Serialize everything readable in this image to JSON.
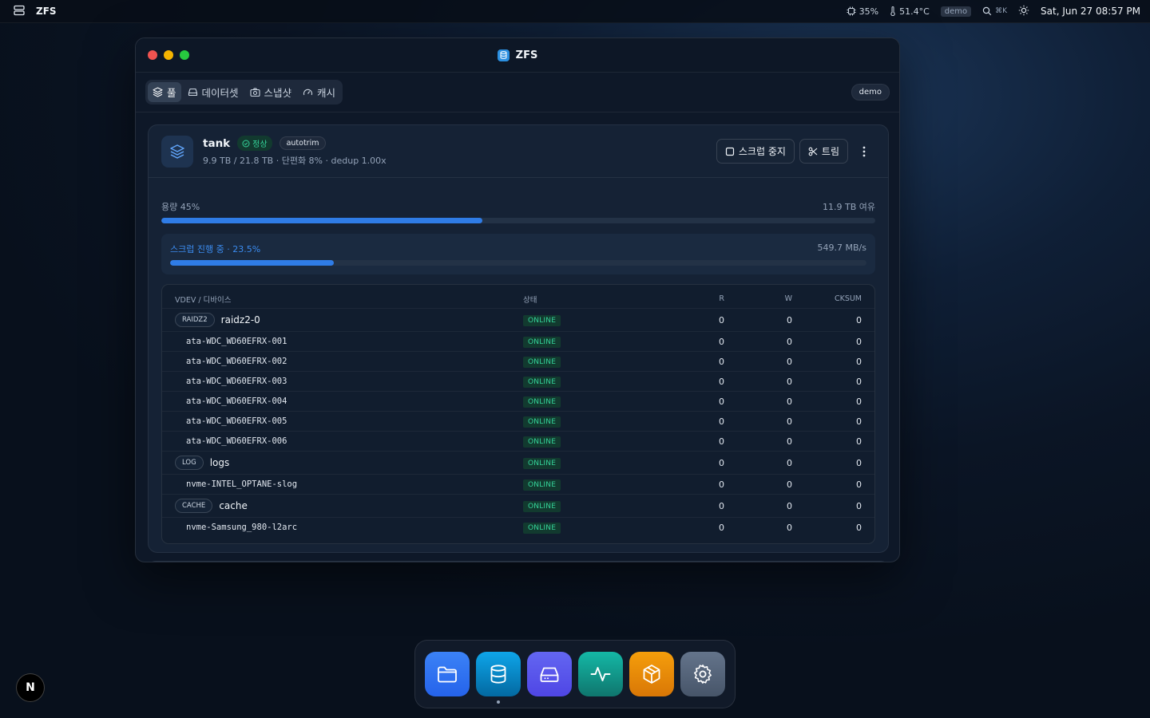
{
  "menubar": {
    "app_name": "ZFS",
    "cpu": "35%",
    "temp": "51.4°C",
    "mode_badge": "demo",
    "search_shortcut": "⌘K",
    "clock": "Sat, Jun 27 08:57 PM"
  },
  "window": {
    "title": "ZFS",
    "tabs": [
      {
        "label": "풀",
        "icon": "layers-icon",
        "active": true
      },
      {
        "label": "데이터셋",
        "icon": "drive-icon",
        "active": false
      },
      {
        "label": "스냅샷",
        "icon": "camera-icon",
        "active": false
      },
      {
        "label": "캐시",
        "icon": "gauge-icon",
        "active": false
      }
    ],
    "demo_pill": "demo"
  },
  "pool": {
    "name": "tank",
    "status": "정상",
    "tag": "autotrim",
    "summary": "9.9 TB / 21.8 TB · 단편화 8% · dedup 1.00x",
    "actions": {
      "scrub_stop": "스크럽 중지",
      "trim": "트림"
    },
    "capacity": {
      "label": "용량 45%",
      "free": "11.9 TB 여유",
      "percent": 45
    },
    "scrub": {
      "label": "스크럽 진행 중 · 23.5%",
      "speed": "549.7 MB/s",
      "percent": 23.5
    }
  },
  "vdev_table": {
    "headers": {
      "name": "VDEV / 디바이스",
      "state": "상태",
      "r": "R",
      "w": "W",
      "cksum": "CKSUM"
    },
    "rows": [
      {
        "type": "group",
        "badge": "RAIDZ2",
        "name": "raidz2-0",
        "state": "ONLINE",
        "r": "0",
        "w": "0",
        "cksum": "0"
      },
      {
        "type": "device",
        "name": "ata-WDC_WD60EFRX-001",
        "state": "ONLINE",
        "r": "0",
        "w": "0",
        "cksum": "0"
      },
      {
        "type": "device",
        "name": "ata-WDC_WD60EFRX-002",
        "state": "ONLINE",
        "r": "0",
        "w": "0",
        "cksum": "0"
      },
      {
        "type": "device",
        "name": "ata-WDC_WD60EFRX-003",
        "state": "ONLINE",
        "r": "0",
        "w": "0",
        "cksum": "0"
      },
      {
        "type": "device",
        "name": "ata-WDC_WD60EFRX-004",
        "state": "ONLINE",
        "r": "0",
        "w": "0",
        "cksum": "0"
      },
      {
        "type": "device",
        "name": "ata-WDC_WD60EFRX-005",
        "state": "ONLINE",
        "r": "0",
        "w": "0",
        "cksum": "0"
      },
      {
        "type": "device",
        "name": "ata-WDC_WD60EFRX-006",
        "state": "ONLINE",
        "r": "0",
        "w": "0",
        "cksum": "0"
      },
      {
        "type": "group",
        "badge": "LOG",
        "name": "logs",
        "state": "ONLINE",
        "r": "0",
        "w": "0",
        "cksum": "0"
      },
      {
        "type": "device",
        "name": "nvme-INTEL_OPTANE-slog",
        "state": "ONLINE",
        "r": "0",
        "w": "0",
        "cksum": "0"
      },
      {
        "type": "group",
        "badge": "CACHE",
        "name": "cache",
        "state": "ONLINE",
        "r": "0",
        "w": "0",
        "cksum": "0"
      },
      {
        "type": "device",
        "name": "nvme-Samsung_980-l2arc",
        "state": "ONLINE",
        "r": "0",
        "w": "0",
        "cksum": "0"
      }
    ]
  },
  "dock": {
    "items": [
      {
        "name": "files",
        "icon": "folder-icon"
      },
      {
        "name": "zfs",
        "icon": "database-icon",
        "running": true
      },
      {
        "name": "disks",
        "icon": "hard-drive-icon"
      },
      {
        "name": "monitor",
        "icon": "activity-icon"
      },
      {
        "name": "packages",
        "icon": "box-icon"
      },
      {
        "name": "settings",
        "icon": "gear-icon"
      }
    ]
  },
  "corner_button": "N",
  "colors": {
    "accent": "#2f7ce6",
    "online": "#34d399",
    "close": "#ef5350",
    "minimize": "#f4b400",
    "maximize": "#27c93f"
  }
}
